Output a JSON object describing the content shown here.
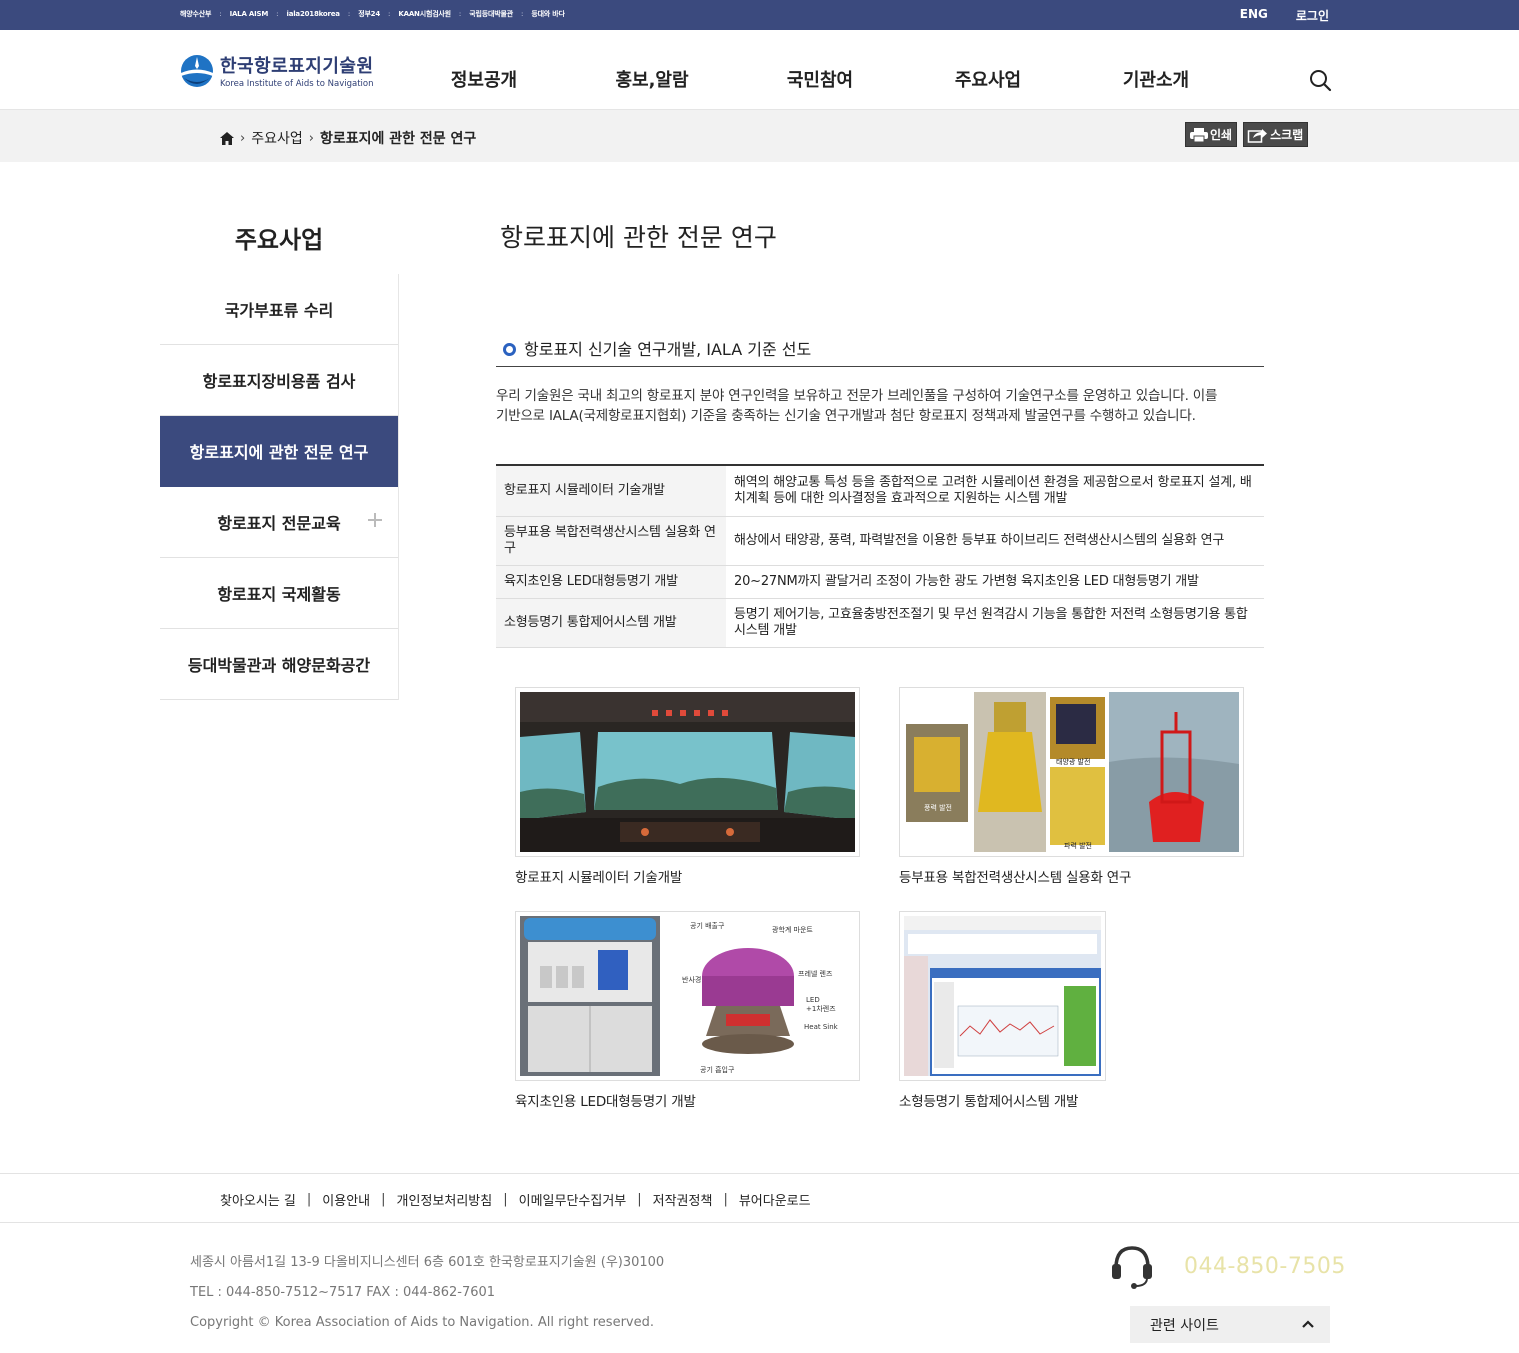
{
  "topbar": {
    "links": [
      "해양수산부",
      "IALA AISM",
      "iala2018korea",
      "정부24",
      "KAAN시험검사원",
      "국립등대박물관",
      "등대와 바다"
    ],
    "eng_label": "ENG",
    "login_label": "로그인"
  },
  "header": {
    "logo_ko": "한국항로표지기술원",
    "logo_en": "Korea Institute of Aids to Navigation",
    "nav": [
      "정보공개",
      "홍보,알람",
      "국민참여",
      "주요사업",
      "기관소개"
    ],
    "search_icon": "search-icon"
  },
  "location": {
    "crumb_1": "주요사업",
    "crumb_2": "항로표지에 관한 전문 연구",
    "print_label": "인쇄",
    "scrap_label": "스크랩"
  },
  "side": {
    "title": "주요사업",
    "items": [
      {
        "label": "국가부표류 수리",
        "active": false
      },
      {
        "label": "항로표지장비용품 검사",
        "active": false
      },
      {
        "label": "항로표지에 관한 전문 연구",
        "active": true
      },
      {
        "label": "항로표지 전문교육",
        "active": false
      },
      {
        "label": "항로표지 국제활동",
        "active": false
      },
      {
        "label": "등대박물관과 해양문화공간",
        "active": false
      }
    ]
  },
  "content": {
    "title": "항로표지에 관한 전문 연구",
    "section_heading": "항로표지 신기술 연구개발, IALA 기준 선도",
    "intro_line1": "우리 기술원은 국내 최고의 항로표지 분야 연구인력을 보유하고 전문가 브레인풀을 구성하여 기술연구소를 운영하고 있습니다. 이를",
    "intro_line2": "기반으로 IALA(국제항로표지협회) 기준을 충족하는 신기술 연구개발과 첨단 항로표지 정책과제 발굴연구를 수행하고 있습니다.",
    "table": [
      {
        "k": "항로표지 시뮬레이터 기술개발",
        "v": "해역의 해양교통 특성 등을 종합적으로 고려한 시뮬레이션 환경을 제공함으로서 항로표지 설계, 배치계획 등에 대한 의사결정을 효과적으로 지원하는 시스템 개발"
      },
      {
        "k": "등부표용 복합전력생산시스템 실용화 연구",
        "v": "해상에서 태양광, 풍력, 파력발전을 이용한 등부표 하이브리드 전력생산시스템의 실용화 연구"
      },
      {
        "k": "육지초인용 LED대형등명기 개발",
        "v": "20~27NM까지 괄달거리 조정이 가능한 광도 가변형 육지초인용 LED 대형등명기 개발"
      },
      {
        "k": "소형등명기 통합제어시스템 개발",
        "v": "등명기 제어기능, 고효율충방전조절기 및 무선 원격감시 기능을 통합한 저전력 소형등명기용 통합시스템 개발"
      }
    ],
    "gallery": [
      {
        "caption": "항로표지 시뮬레이터 기술개발"
      },
      {
        "caption": "등부표용 복합전력생산시스템 실용화 연구",
        "labels": [
          "풍력 발전",
          "태양광 발전",
          "파력 발전"
        ]
      },
      {
        "caption": "육지초인용 LED대형등명기 개발",
        "labels": [
          "공기 배출구",
          "광학계 마운트",
          "반사경",
          "프레넬 렌즈",
          "LED",
          "+1차렌즈",
          "Heat Sink",
          "공기 흡입구"
        ]
      },
      {
        "caption": "소형등명기 통합제어시스템 개발"
      }
    ]
  },
  "footer": {
    "links": [
      "찾아오시는 길",
      "이용안내",
      "개인정보처리방침",
      "이메일무단수집거부",
      "저작권정책",
      "뷰어다운로드"
    ],
    "address": "세종시 아름서1길 13-9 다올비지니스센터 6층 601호 한국항로표지기술원 (우)30100",
    "tel": "TEL : 044-850-7512~7517 FAX : 044-862-7601",
    "copyright": "Copyright © Korea Association of Aids to Navigation. All right reserved.",
    "phone": "044-850-7505",
    "related_label": "관련 사이트"
  }
}
